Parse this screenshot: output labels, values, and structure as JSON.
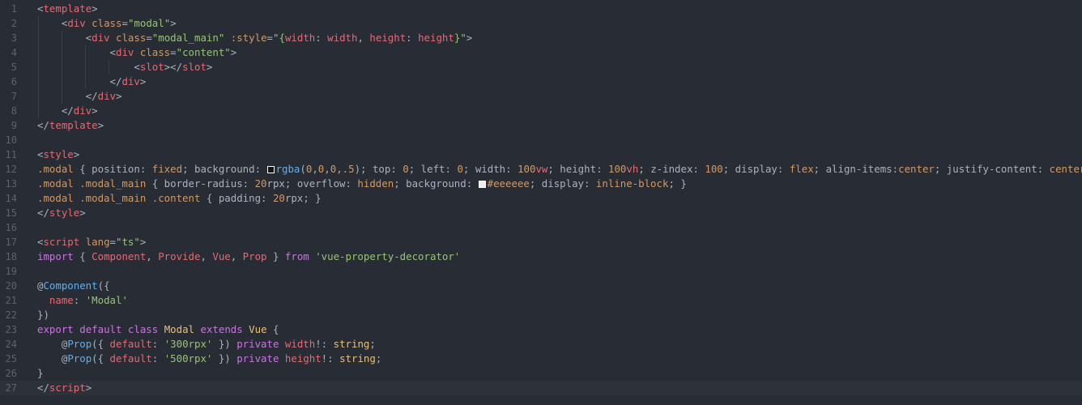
{
  "colors": {
    "background": "#282c34",
    "current_line": "#2c313a",
    "swatch_rgba": "rgba(0,0,0,.5)",
    "swatch_eee": "#eeeeee"
  },
  "current_line": 27,
  "lines": [
    [
      [
        "<",
        "pun"
      ],
      [
        "template",
        "tag"
      ],
      [
        ">",
        "pun"
      ]
    ],
    [
      [
        "    <",
        "pun"
      ],
      [
        "div",
        "tag"
      ],
      [
        " ",
        "pun"
      ],
      [
        "class",
        "attr"
      ],
      [
        "=",
        "pun"
      ],
      [
        "\"modal\"",
        "str"
      ],
      [
        ">",
        "pun"
      ]
    ],
    [
      [
        "        <",
        "pun"
      ],
      [
        "div",
        "tag"
      ],
      [
        " ",
        "pun"
      ],
      [
        "class",
        "attr"
      ],
      [
        "=",
        "pun"
      ],
      [
        "\"modal_main\"",
        "str"
      ],
      [
        " ",
        "pun"
      ],
      [
        ":style",
        "attr"
      ],
      [
        "=",
        "pun"
      ],
      [
        "\"{",
        "str"
      ],
      [
        "width",
        "var"
      ],
      [
        ": ",
        "pun"
      ],
      [
        "width",
        "var"
      ],
      [
        ", ",
        "pun"
      ],
      [
        "height",
        "var"
      ],
      [
        ": ",
        "pun"
      ],
      [
        "height",
        "var"
      ],
      [
        "}\"",
        "str"
      ],
      [
        ">",
        "pun"
      ]
    ],
    [
      [
        "            <",
        "pun"
      ],
      [
        "div",
        "tag"
      ],
      [
        " ",
        "pun"
      ],
      [
        "class",
        "attr"
      ],
      [
        "=",
        "pun"
      ],
      [
        "\"content\"",
        "str"
      ],
      [
        ">",
        "pun"
      ]
    ],
    [
      [
        "                <",
        "pun"
      ],
      [
        "slot",
        "tag"
      ],
      [
        "></",
        "pun"
      ],
      [
        "slot",
        "tag"
      ],
      [
        ">",
        "pun"
      ]
    ],
    [
      [
        "            </",
        "pun"
      ],
      [
        "div",
        "tag"
      ],
      [
        ">",
        "pun"
      ]
    ],
    [
      [
        "        </",
        "pun"
      ],
      [
        "div",
        "tag"
      ],
      [
        ">",
        "pun"
      ]
    ],
    [
      [
        "    </",
        "pun"
      ],
      [
        "div",
        "tag"
      ],
      [
        ">",
        "pun"
      ]
    ],
    [
      [
        "</",
        "pun"
      ],
      [
        "template",
        "tag"
      ],
      [
        ">",
        "pun"
      ]
    ],
    [],
    [
      [
        "<",
        "pun"
      ],
      [
        "style",
        "tag"
      ],
      [
        ">",
        "pun"
      ]
    ],
    [
      [
        ".modal",
        "sel"
      ],
      [
        " { ",
        "pun"
      ],
      [
        "position",
        "prop"
      ],
      [
        ": ",
        "pun"
      ],
      [
        "fixed",
        "val"
      ],
      [
        "; ",
        "pun"
      ],
      [
        "background",
        "prop"
      ],
      [
        ": ",
        "pun"
      ],
      [
        "",
        "swatch-rgba"
      ],
      [
        "rgba",
        "fn"
      ],
      [
        "(",
        "pun"
      ],
      [
        "0",
        "num"
      ],
      [
        ",",
        "pun"
      ],
      [
        "0",
        "num"
      ],
      [
        ",",
        "pun"
      ],
      [
        "0",
        "num"
      ],
      [
        ",",
        "pun"
      ],
      [
        ".5",
        "num"
      ],
      [
        "); ",
        "pun"
      ],
      [
        "top",
        "prop"
      ],
      [
        ": ",
        "pun"
      ],
      [
        "0",
        "num"
      ],
      [
        "; ",
        "pun"
      ],
      [
        "left",
        "prop"
      ],
      [
        ": ",
        "pun"
      ],
      [
        "0",
        "num"
      ],
      [
        "; ",
        "pun"
      ],
      [
        "width",
        "prop"
      ],
      [
        ": ",
        "pun"
      ],
      [
        "100",
        "num"
      ],
      [
        "vw",
        "var"
      ],
      [
        "; ",
        "pun"
      ],
      [
        "height",
        "prop"
      ],
      [
        ": ",
        "pun"
      ],
      [
        "100",
        "num"
      ],
      [
        "vh",
        "var"
      ],
      [
        "; ",
        "pun"
      ],
      [
        "z-index",
        "prop"
      ],
      [
        ": ",
        "pun"
      ],
      [
        "100",
        "num"
      ],
      [
        "; ",
        "pun"
      ],
      [
        "display",
        "prop"
      ],
      [
        ": ",
        "pun"
      ],
      [
        "flex",
        "val"
      ],
      [
        "; ",
        "pun"
      ],
      [
        "align-items",
        "prop"
      ],
      [
        ":",
        "pun"
      ],
      [
        "center",
        "val"
      ],
      [
        "; ",
        "pun"
      ],
      [
        "justify-content",
        "prop"
      ],
      [
        ": ",
        "pun"
      ],
      [
        "center",
        "val"
      ],
      [
        "; }",
        "pun"
      ]
    ],
    [
      [
        ".modal .modal_main",
        "sel"
      ],
      [
        " { ",
        "pun"
      ],
      [
        "border-radius",
        "prop"
      ],
      [
        ": ",
        "pun"
      ],
      [
        "20",
        "num"
      ],
      [
        "rpx",
        "prop"
      ],
      [
        "; ",
        "pun"
      ],
      [
        "overflow",
        "prop"
      ],
      [
        ": ",
        "pun"
      ],
      [
        "hidden",
        "val"
      ],
      [
        "; ",
        "pun"
      ],
      [
        "background",
        "prop"
      ],
      [
        ": ",
        "pun"
      ],
      [
        "",
        "swatch-eee"
      ],
      [
        "#eeeeee",
        "val"
      ],
      [
        "; ",
        "pun"
      ],
      [
        "display",
        "prop"
      ],
      [
        ": ",
        "pun"
      ],
      [
        "inline-block",
        "val"
      ],
      [
        "; }",
        "pun"
      ]
    ],
    [
      [
        ".modal .modal_main .content",
        "sel"
      ],
      [
        " { ",
        "pun"
      ],
      [
        "padding",
        "prop"
      ],
      [
        ": ",
        "pun"
      ],
      [
        "20",
        "num"
      ],
      [
        "rpx",
        "prop"
      ],
      [
        "; }",
        "pun"
      ]
    ],
    [
      [
        "</",
        "pun"
      ],
      [
        "style",
        "tag"
      ],
      [
        ">",
        "pun"
      ]
    ],
    [],
    [
      [
        "<",
        "pun"
      ],
      [
        "script",
        "tag"
      ],
      [
        " ",
        "pun"
      ],
      [
        "lang",
        "attr"
      ],
      [
        "=",
        "pun"
      ],
      [
        "\"ts\"",
        "str"
      ],
      [
        ">",
        "pun"
      ]
    ],
    [
      [
        "import",
        "kw"
      ],
      [
        " { ",
        "pun"
      ],
      [
        "Component",
        "var"
      ],
      [
        ", ",
        "pun"
      ],
      [
        "Provide",
        "var"
      ],
      [
        ", ",
        "pun"
      ],
      [
        "Vue",
        "var"
      ],
      [
        ", ",
        "pun"
      ],
      [
        "Prop",
        "var"
      ],
      [
        " } ",
        "pun"
      ],
      [
        "from",
        "kw"
      ],
      [
        " ",
        "pun"
      ],
      [
        "'vue-property-decorator'",
        "str"
      ]
    ],
    [],
    [
      [
        "@",
        "pun"
      ],
      [
        "Component",
        "fn"
      ],
      [
        "({",
        "pun"
      ]
    ],
    [
      [
        "  name",
        "var"
      ],
      [
        ": ",
        "pun"
      ],
      [
        "'Modal'",
        "str"
      ]
    ],
    [
      [
        "})",
        "pun"
      ]
    ],
    [
      [
        "export",
        "kw"
      ],
      [
        " ",
        "pun"
      ],
      [
        "default",
        "kw"
      ],
      [
        " ",
        "pun"
      ],
      [
        "class",
        "kw"
      ],
      [
        " ",
        "pun"
      ],
      [
        "Modal",
        "cls"
      ],
      [
        " ",
        "pun"
      ],
      [
        "extends",
        "kw"
      ],
      [
        " ",
        "pun"
      ],
      [
        "Vue",
        "cls"
      ],
      [
        " {",
        "pun"
      ]
    ],
    [
      [
        "    @",
        "pun"
      ],
      [
        "Prop",
        "fn"
      ],
      [
        "({ ",
        "pun"
      ],
      [
        "default",
        "var"
      ],
      [
        ": ",
        "pun"
      ],
      [
        "'300rpx'",
        "str"
      ],
      [
        " }) ",
        "pun"
      ],
      [
        "private",
        "kw"
      ],
      [
        " ",
        "pun"
      ],
      [
        "width",
        "var"
      ],
      [
        "!: ",
        "pun"
      ],
      [
        "string",
        "cls"
      ],
      [
        ";",
        "pun"
      ]
    ],
    [
      [
        "    @",
        "pun"
      ],
      [
        "Prop",
        "fn"
      ],
      [
        "({ ",
        "pun"
      ],
      [
        "default",
        "var"
      ],
      [
        ": ",
        "pun"
      ],
      [
        "'500rpx'",
        "str"
      ],
      [
        " }) ",
        "pun"
      ],
      [
        "private",
        "kw"
      ],
      [
        " ",
        "pun"
      ],
      [
        "height",
        "var"
      ],
      [
        "!: ",
        "pun"
      ],
      [
        "string",
        "cls"
      ],
      [
        ";",
        "pun"
      ]
    ],
    [
      [
        "}",
        "pun"
      ]
    ],
    [
      [
        "</",
        "pun"
      ],
      [
        "script",
        "tag"
      ],
      [
        ">",
        "pun"
      ]
    ]
  ]
}
